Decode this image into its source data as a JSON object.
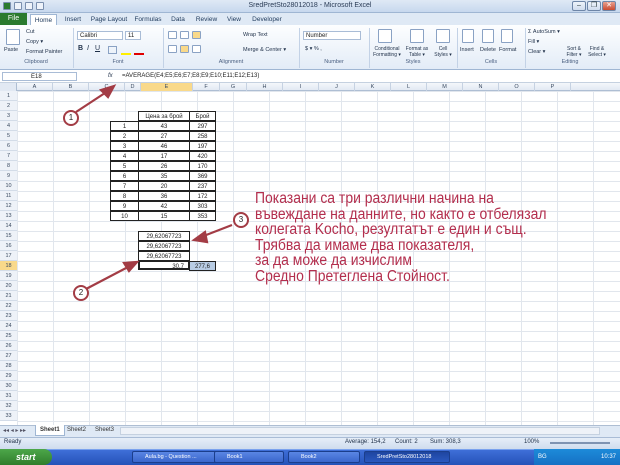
{
  "window": {
    "title": "SredPretSto28012018 - Microsoft Excel",
    "controls": [
      "–",
      "❐",
      "✕"
    ]
  },
  "tabs": [
    "File",
    "Home",
    "Insert",
    "Page Layout",
    "Formulas",
    "Data",
    "Review",
    "View",
    "Developer"
  ],
  "ribbon": {
    "clipboard": {
      "paste": "Paste",
      "cut": "Cut",
      "copy": "Copy ▾",
      "format_painter": "Format Painter",
      "group": "Clipboard"
    },
    "font": {
      "name": "Calibri",
      "size": "11",
      "group": "Font"
    },
    "alignment": {
      "wrap": "Wrap Text",
      "merge": "Merge & Center ▾",
      "group": "Alignment"
    },
    "number": {
      "format": "Number",
      "symbols": "$ ▾ % ,",
      "group": "Number"
    },
    "styles": {
      "conditional": "Conditional Formatting ▾",
      "format_table": "Format as Table ▾",
      "cell_styles": "Cell Styles ▾",
      "group": "Styles"
    },
    "cells": {
      "insert": "Insert",
      "delete": "Delete",
      "format": "Format",
      "group": "Cells"
    },
    "editing": {
      "autosum": "Σ AutoSum ▾",
      "fill": "Fill ▾",
      "clear": "Clear ▾",
      "sort": "Sort & Filter ▾",
      "find": "Find & Select ▾",
      "group": "Editing"
    }
  },
  "formula_bar": {
    "name_box": "E18",
    "fx": "fx",
    "formula": "=AVERAGE(E4;E5;E6;E7;E8;E9;E10;E11;E12;E13)"
  },
  "columns": [
    "A",
    "B",
    "C",
    "D",
    "E",
    "F",
    "G",
    "H",
    "I",
    "J",
    "K",
    "L",
    "M",
    "N",
    "O",
    "P"
  ],
  "rows": [
    "1",
    "2",
    "3",
    "4",
    "5",
    "6",
    "7",
    "8",
    "9",
    "10",
    "11",
    "12",
    "13",
    "14",
    "15",
    "16",
    "17",
    "18",
    "19",
    "20",
    "21",
    "22",
    "23",
    "24",
    "25",
    "26",
    "27",
    "28",
    "29",
    "30",
    "31",
    "32",
    "33"
  ],
  "table": {
    "headers": [
      "Цена за брой",
      "Брой"
    ],
    "rows": [
      [
        "1",
        "43",
        "297"
      ],
      [
        "2",
        "27",
        "258"
      ],
      [
        "3",
        "46",
        "197"
      ],
      [
        "4",
        "17",
        "420"
      ],
      [
        "5",
        "26",
        "170"
      ],
      [
        "6",
        "35",
        "369"
      ],
      [
        "7",
        "20",
        "237"
      ],
      [
        "8",
        "36",
        "172"
      ],
      [
        "9",
        "42",
        "303"
      ],
      [
        "10",
        "15",
        "353"
      ]
    ]
  },
  "results": {
    "e15": "29,62067723",
    "e16": "29,62067723",
    "e17": "29,62067723",
    "e18": "30,7",
    "f18": "277,6"
  },
  "note": {
    "lines": [
      "Показани са три различни начина на",
      "въвеждане на данните, но както е отбелязал",
      "колегата Kocho, резултатът е един и същ.",
      "Трябва да имаме два показателя,",
      "за да може да изчислим",
      "Средно Претеглена Стойност."
    ]
  },
  "callouts": [
    "1",
    "2",
    "3"
  ],
  "sheet_tabs": [
    "Sheet1",
    "Sheet2",
    "Sheet3"
  ],
  "status": {
    "ready": "Ready",
    "average": "Average: 154,2",
    "count": "Count: 2",
    "sum": "Sum: 308,3",
    "zoom": "100%"
  },
  "taskbar": {
    "start": "start",
    "items": [
      "Aula.bg - Question ...",
      "Book1",
      "Book2",
      "SredPretSto28012018"
    ],
    "lang": "BG",
    "time": "10:37"
  },
  "colors": {
    "accent": "#b32e4d",
    "file_tab": "#2a7a2e",
    "selection": "#b8cce4"
  }
}
